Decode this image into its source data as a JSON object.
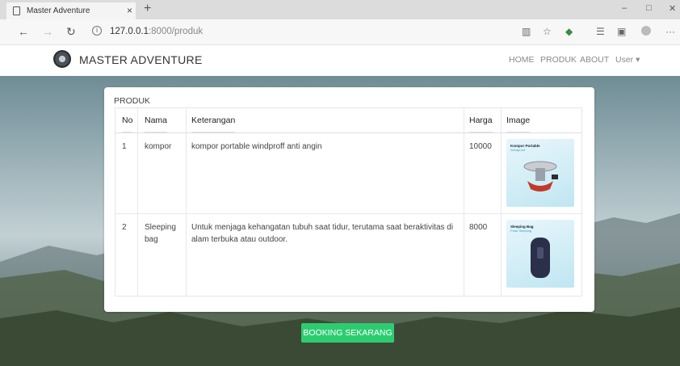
{
  "browser": {
    "tab_title": "Master Adventure",
    "new_tab": "+",
    "url_host": "127.0.0.1",
    "url_rest": ":8000/produk",
    "minimize": "–",
    "restore": "□",
    "close": "✕",
    "more": "···"
  },
  "navbar": {
    "brand": "MASTER ADVENTURE",
    "items": [
      {
        "label": "HOME"
      },
      {
        "label": "PRODUK"
      },
      {
        "label": "ABOUT"
      },
      {
        "label": "User ▾"
      }
    ]
  },
  "produk": {
    "title": "PRODUK",
    "columns": [
      "No",
      "Nama",
      "Keterangan",
      "Harga",
      "Image"
    ],
    "rows": [
      {
        "no": "1",
        "nama": "kompor",
        "keterangan": "kompor portable windproff anti angin",
        "harga": "10000",
        "image": {
          "title": "Kompor Portable",
          "subtitle": "Windproof",
          "icon": "stove-icon"
        }
      },
      {
        "no": "2",
        "nama": "Sleeping bag",
        "keterangan": "Untuk menjaga kehangatan tubuh saat tidur, terutama saat beraktivitas di alam terbuka atau outdoor.",
        "harga": "8000",
        "image": {
          "title": "Sleeping Bag",
          "subtitle": "Polar Sleeping",
          "icon": "sleeping-bag-icon"
        }
      }
    ]
  },
  "cta": {
    "label": "BOOKING SEKARANG"
  },
  "colors": {
    "accent": "#2ecc71",
    "nav_text": "#8a8a8a"
  }
}
